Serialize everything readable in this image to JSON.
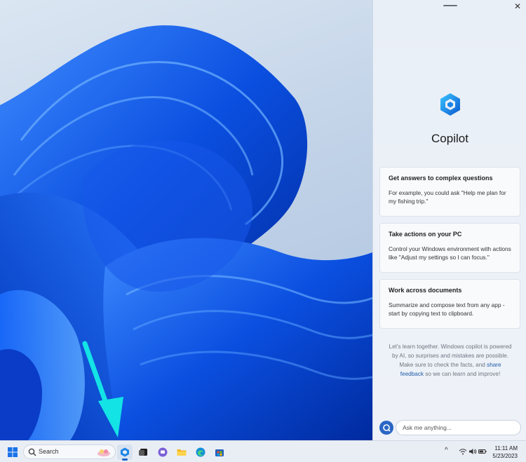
{
  "panel": {
    "title": "Copilot",
    "close_glyph": "✕",
    "cards": [
      {
        "title": "Get answers to complex questions",
        "body": "For example, you could ask \"Help me plan for my fishing trip.\""
      },
      {
        "title": "Take actions on your PC",
        "body": "Control your Windows environment with actions like \"Adjust my settings so I can focus.\""
      },
      {
        "title": "Work across documents",
        "body": "Summarize and compose text from any app - start by copying text to clipboard."
      }
    ],
    "disclaimer_before": "Let's learn together. Windows copilot is powered by AI, so surprises and mistakes are possible. Make sure to check the facts, and ",
    "disclaimer_link": "share feedback",
    "disclaimer_after": " so we can learn and improve!",
    "ask_placeholder": "Ask me anything..."
  },
  "taskbar": {
    "search_label": "Search",
    "clock_time": "11:11 AM",
    "clock_date": "5/23/2023",
    "tray_chevron": "^"
  },
  "colors": {
    "accent": "#1b64c8",
    "link": "#1e5ba8",
    "arrow": "#14e3e6"
  },
  "icons": [
    "windows-logo-icon",
    "search-icon",
    "copilot-icon",
    "task-view-icon",
    "teams-chat-icon",
    "file-explorer-icon",
    "edge-icon",
    "store-icon",
    "wifi-icon",
    "volume-icon",
    "battery-icon",
    "chevron-up-icon",
    "close-icon"
  ]
}
